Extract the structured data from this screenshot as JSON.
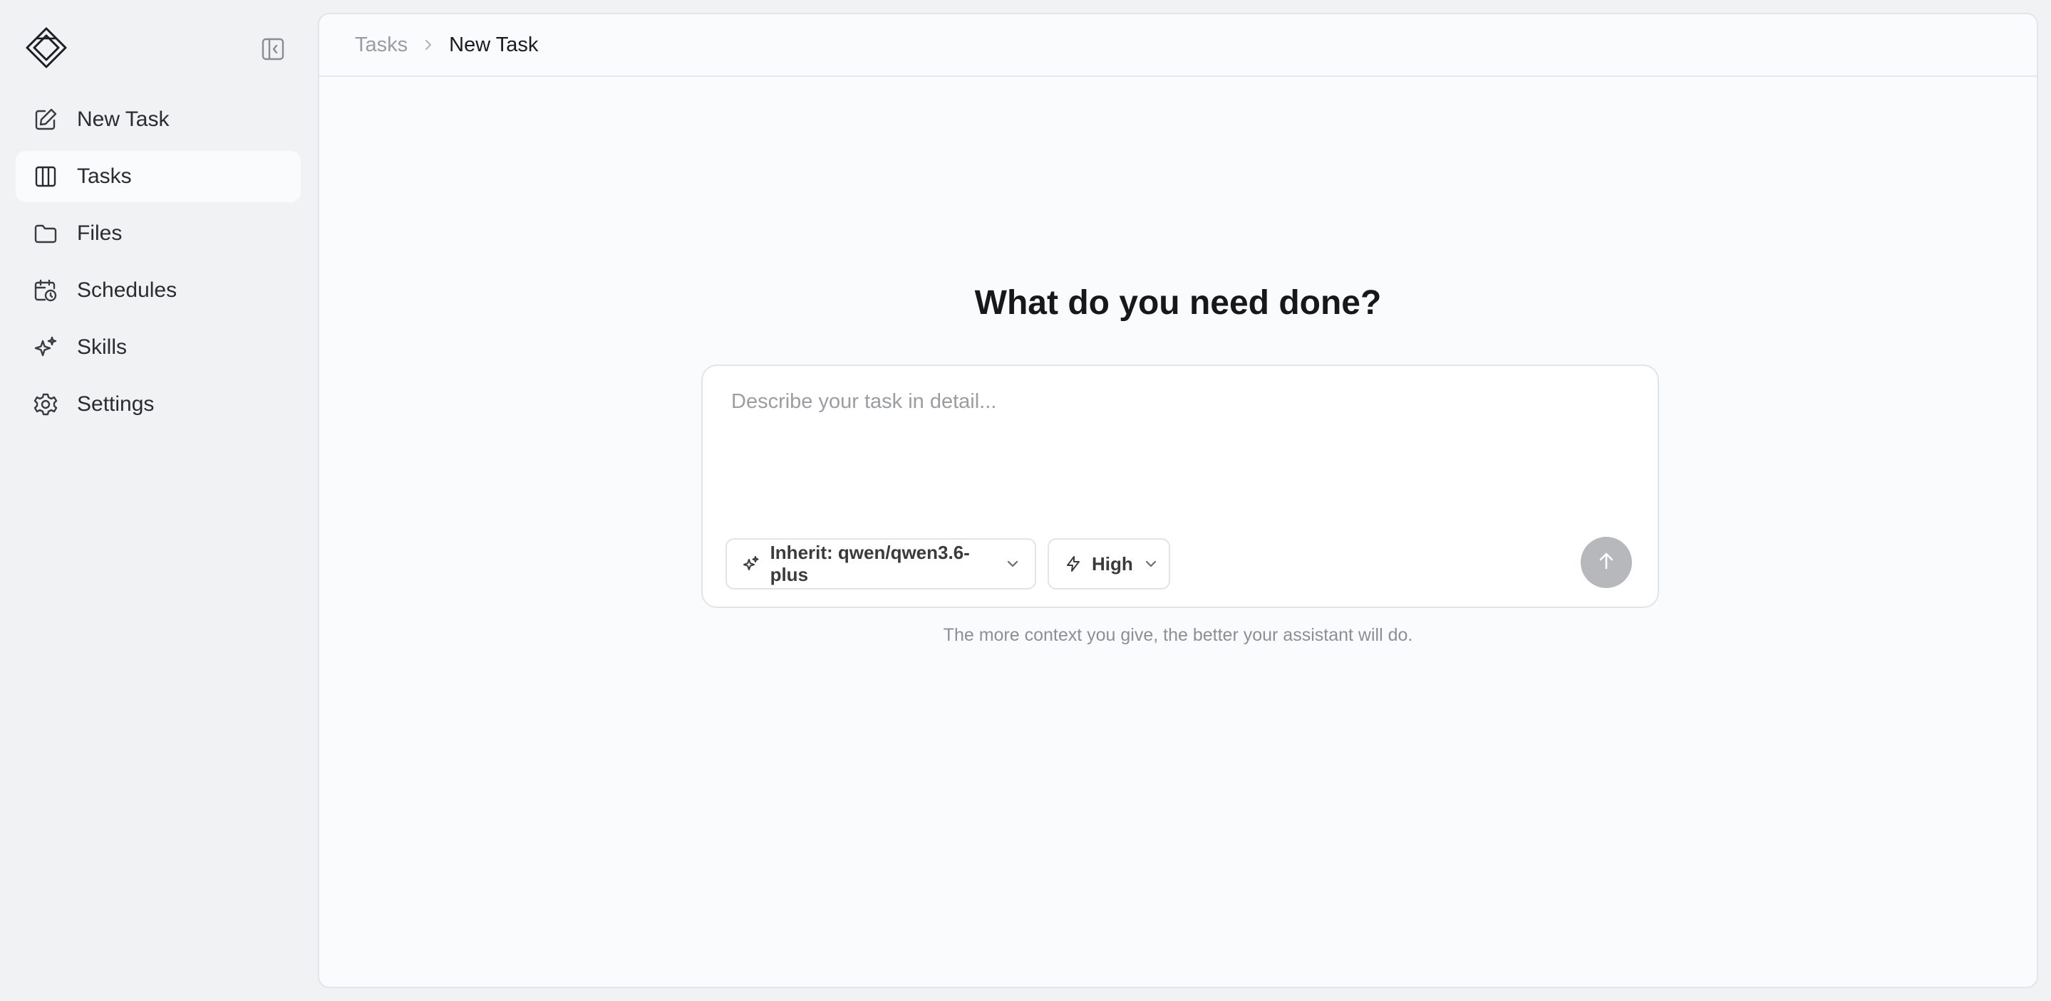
{
  "sidebar": {
    "items": [
      {
        "label": "New Task",
        "icon": "pencil-square-icon",
        "active": false
      },
      {
        "label": "Tasks",
        "icon": "columns-icon",
        "active": true
      },
      {
        "label": "Files",
        "icon": "folder-icon",
        "active": false
      },
      {
        "label": "Schedules",
        "icon": "calendar-clock-icon",
        "active": false
      },
      {
        "label": "Skills",
        "icon": "sparkles-icon",
        "active": false
      },
      {
        "label": "Settings",
        "icon": "gear-icon",
        "active": false
      }
    ]
  },
  "breadcrumb": {
    "parent": "Tasks",
    "current": "New Task"
  },
  "main": {
    "heading": "What do you need done?",
    "input_placeholder": "Describe your task in detail...",
    "input_value": "",
    "model_selector": "Inherit: qwen/qwen3.6-plus",
    "effort_selector": "High",
    "hint": "The more context you give, the better your assistant will do."
  },
  "colors": {
    "background": "#f1f2f4",
    "panel": "#fafbfd",
    "send_button_disabled": "#b7b8bc",
    "active_nav": "#fafbfc"
  }
}
